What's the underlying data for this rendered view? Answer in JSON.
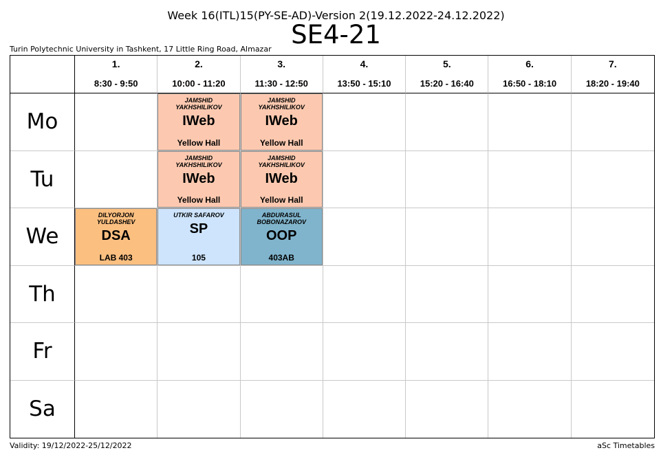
{
  "header": {
    "week_title": "Week 16(ITL)15(PY-SE-AD)-Version 2(19.12.2022-24.12.2022)",
    "class_name": "SE4-21",
    "school": "Turin Polytechnic University in Tashkent, 17 Little Ring Road, Almazar"
  },
  "periods": [
    {
      "num": "1.",
      "time": "8:30 - 9:50"
    },
    {
      "num": "2.",
      "time": "10:00 - 11:20"
    },
    {
      "num": "3.",
      "time": "11:30 - 12:50"
    },
    {
      "num": "4.",
      "time": "13:50 - 15:10"
    },
    {
      "num": "5.",
      "time": "15:20 - 16:40"
    },
    {
      "num": "6.",
      "time": "16:50 - 18:10"
    },
    {
      "num": "7.",
      "time": "18:20 - 19:40"
    }
  ],
  "days": [
    "Mo",
    "Tu",
    "We",
    "Th",
    "Fr",
    "Sa"
  ],
  "lessons": [
    {
      "day": 0,
      "period": 1,
      "teacher": "JAMSHID YAKHSHILIKOV",
      "subject": "IWeb",
      "room": "Yellow Hall",
      "color": "#fcc9b0"
    },
    {
      "day": 0,
      "period": 2,
      "teacher": "JAMSHID YAKHSHILIKOV",
      "subject": "IWeb",
      "room": "Yellow Hall",
      "color": "#fcc9b0"
    },
    {
      "day": 1,
      "period": 1,
      "teacher": "JAMSHID YAKHSHILIKOV",
      "subject": "IWeb",
      "room": "Yellow Hall",
      "color": "#fcc9b0"
    },
    {
      "day": 1,
      "period": 2,
      "teacher": "JAMSHID YAKHSHILIKOV",
      "subject": "IWeb",
      "room": "Yellow Hall",
      "color": "#fcc9b0"
    },
    {
      "day": 2,
      "period": 0,
      "teacher": "DILYORJON YULDASHEV",
      "subject": "DSA",
      "room": "LAB 403",
      "color": "#fbbf80"
    },
    {
      "day": 2,
      "period": 1,
      "teacher": "UTKIR SAFAROV",
      "subject": "SP",
      "room": "105",
      "color": "#cde4fc"
    },
    {
      "day": 2,
      "period": 2,
      "teacher": "ABDURASUL BOBONAZAROV",
      "subject": "OOP",
      "room": "403AB",
      "color": "#80b4cc"
    }
  ],
  "footer": {
    "validity": "Validity: 19/12/2022-25/12/2022",
    "generator": "aSc Timetables"
  }
}
